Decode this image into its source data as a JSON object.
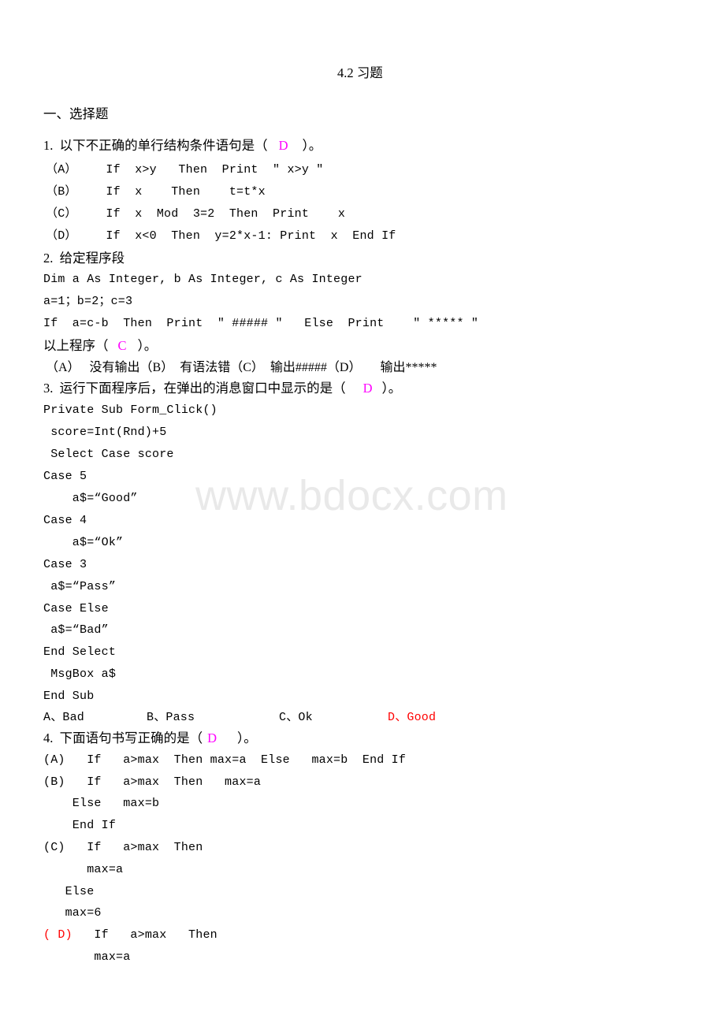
{
  "document": {
    "title": "4.2 习题",
    "watermark": "www.bdocx.com",
    "section_heading": "一、选择题"
  },
  "colors": {
    "answer_magenta": "#ff00ff",
    "answer_red": "#ff0000",
    "text": "#000000",
    "watermark": "#e9e9e9",
    "page_background": "#ffffff"
  },
  "questions": [
    {
      "number": "1.",
      "stem_before": "1.  以下不正确的单行结构条件语句是（",
      "answer": "D",
      "stem_after": "）。",
      "options": [
        "（A）    If  x>y   Then  Print  \" x>y \"",
        "（B）    If  x    Then    t=t*x",
        "（C）    If  x  Mod  3=2  Then  Print    x",
        "（D）    If  x<0  Then  y=2*x-1: Print  x  End If"
      ]
    },
    {
      "number": "2.",
      "stem": "2.  给定程序段",
      "code": [
        "Dim a As Integer, b As Integer, c As Integer",
        "a=1；b=2；c=3",
        "If  a=c-b  Then  Print  \" ##### \"   Else  Print    \" ***** \""
      ],
      "conclusion_before": "以上程序（",
      "answer": "C",
      "conclusion_after": "）。",
      "options_line": "（A）   没有输出（B）  有语法错（C）  输出#####（D）      输出*****"
    },
    {
      "number": "3.",
      "stem_before": "3.  运行下面程序后，在弹出的消息窗口中显示的是（",
      "answer": "D",
      "stem_after": "）。",
      "code": [
        "Private Sub Form_Click()",
        " score=Int(Rnd)+5",
        " Select Case score",
        "Case 5",
        "    a$=“Good”",
        "Case 4",
        "    a$=“Ok”",
        "Case 3",
        " a$=“Pass”",
        "Case Else",
        " a$=“Bad”",
        "End Select",
        " MsgBox a$",
        "End Sub"
      ],
      "choices": [
        {
          "label": "A、Bad",
          "highlighted": false
        },
        {
          "label": "B、Pass",
          "highlighted": false
        },
        {
          "label": "C、Ok",
          "highlighted": false
        },
        {
          "label": "D、Good",
          "highlighted": true
        }
      ]
    },
    {
      "number": "4.",
      "stem_before": "4.  下面语句书写正确的是（",
      "answer": "D",
      "stem_after": "）。",
      "option_lines": [
        "(A)   If   a>max  Then max=a  Else   max=b  End If",
        "(B)   If   a>max  Then   max=a",
        "    Else   max=b",
        "    End If",
        "(C)   If   a>max  Then",
        "      max=a",
        "   Else",
        "   max=6"
      ],
      "option_d_marker": "( D)",
      "option_d_rest": "   If   a>max   Then",
      "option_d_body": "       max=a"
    }
  ]
}
